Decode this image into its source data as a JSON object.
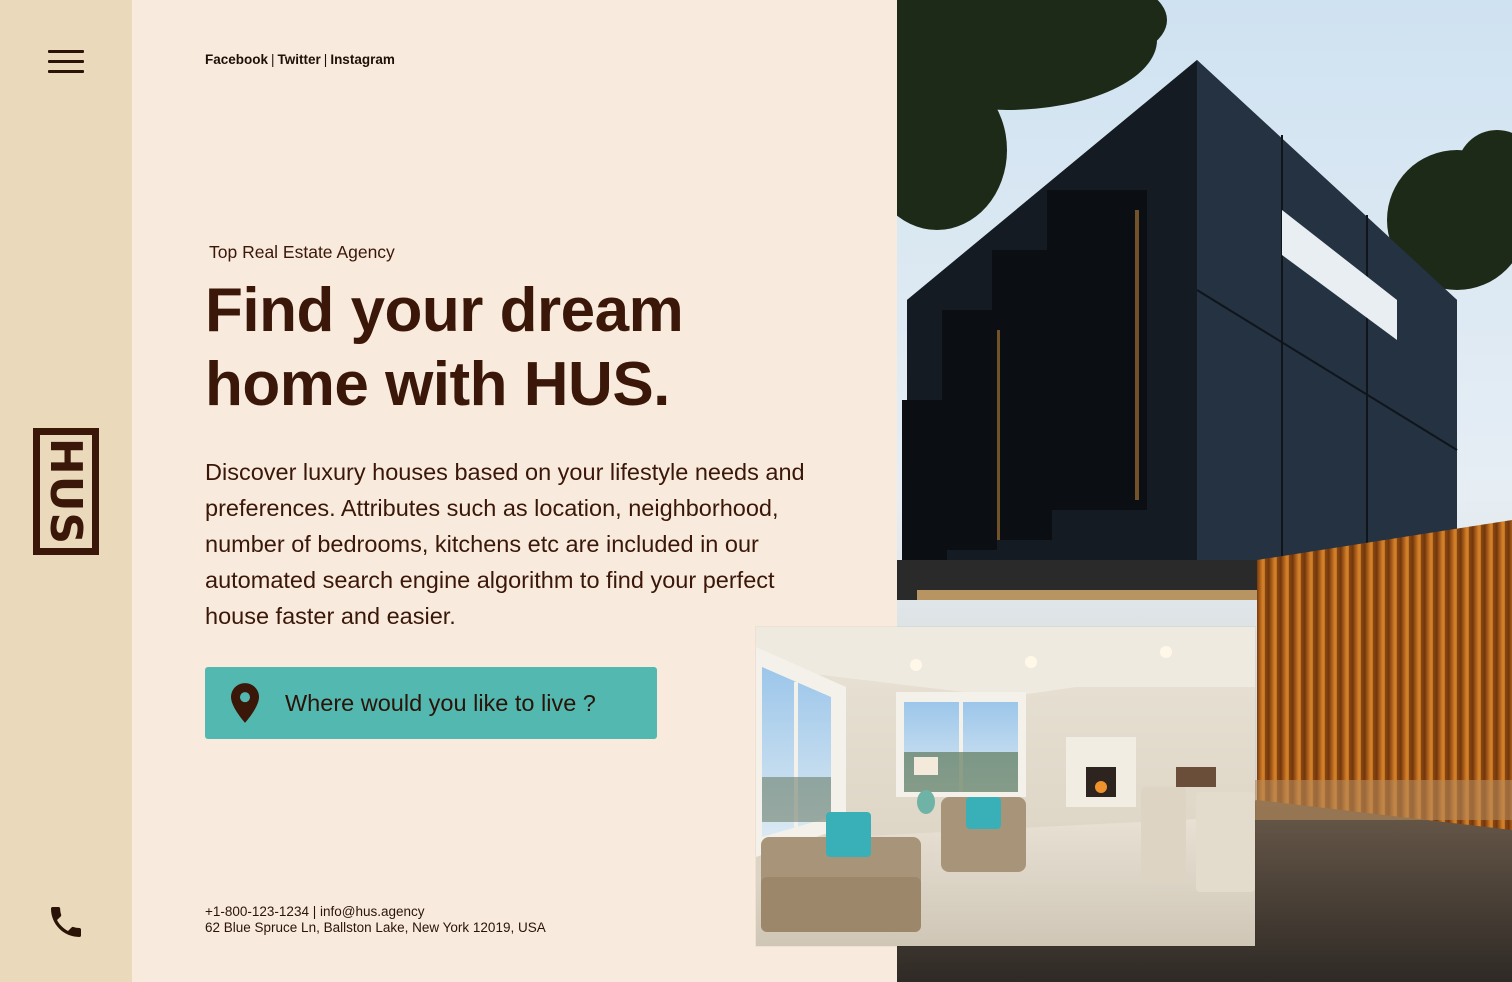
{
  "nav": {
    "menu_icon": "hamburger-menu-icon",
    "logo_text": "HUS",
    "phone_icon": "phone-icon"
  },
  "social": {
    "facebook": "Facebook",
    "twitter": "Twitter",
    "instagram": "Instagram",
    "separator": "|"
  },
  "hero": {
    "eyebrow": "Top Real Estate Agency",
    "headline_line1": "Find your dream",
    "headline_line2": "home with HUS.",
    "description": "Discover luxury houses based on your lifestyle needs and preferences. Attributes such as location, neighborhood, number of bedrooms, kitchens etc are included in our automated search engine algorithm to find your perfect house faster and easier."
  },
  "search": {
    "placeholder": "Where would you like to live ?",
    "icon": "location-pin-icon"
  },
  "contact": {
    "phone_email": "+1-800-123-1234 | info@hus.agency",
    "address": "62 Blue Spruce Ln, Ballston Lake, New York 12019, USA"
  },
  "colors": {
    "background": "#f8ebdd",
    "rail": "#ebd9bb",
    "text": "#3a1708",
    "accent": "#52b8b0"
  }
}
